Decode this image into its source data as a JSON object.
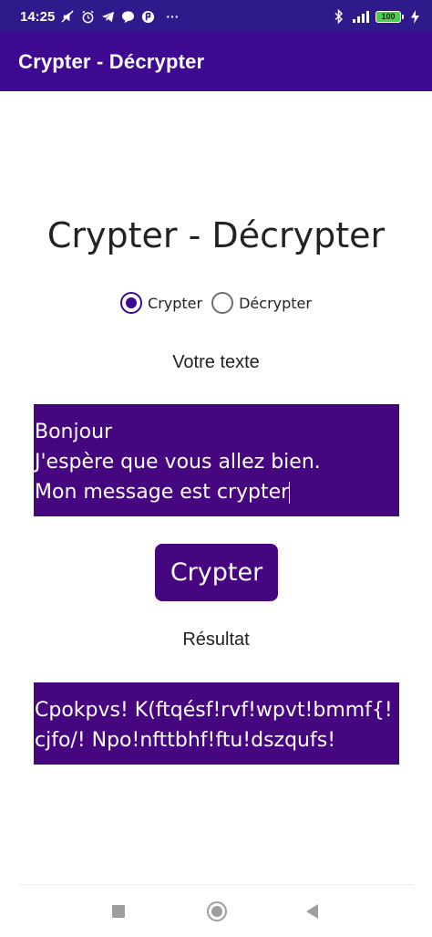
{
  "status_bar": {
    "time": "14:25",
    "more": "···",
    "battery": "100",
    "signal_icon": "signal-icon",
    "wifi_icon": "wifi-icon",
    "bluetooth_icon": "bluetooth-icon",
    "charging_icon": "charging-icon"
  },
  "app_bar": {
    "title": "Crypter - Décrypter"
  },
  "main": {
    "title": "Crypter - Décrypter",
    "radio_crypt": "Crypter",
    "radio_decrypt": "Décrypter",
    "selected": "Crypter",
    "input_label": "Votre texte",
    "input_value": "Bonjour\nJ'espère que vous allez bien.\nMon message est crypter",
    "button_label": "Crypter",
    "result_label": "Résultat",
    "result_value": "Cpokpvs! K(ftqésf!rvf!wpvt!bmmf{!\ncjfo/! Npo!nfttbhf!ftu!dszqufs!"
  },
  "colors": {
    "status_bar": "#2f1a8c",
    "app_bar": "#3d0a91",
    "accent": "#46067f",
    "text": "#222222"
  }
}
